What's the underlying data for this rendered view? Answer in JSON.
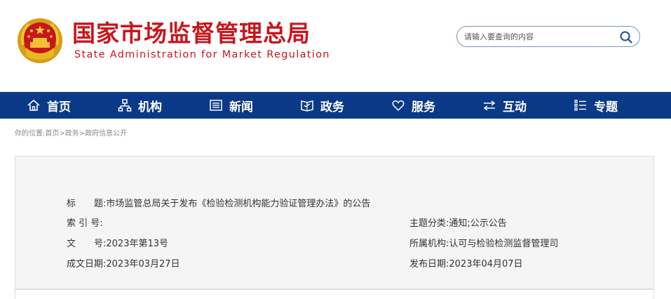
{
  "header": {
    "title_cn": "国家市场监督管理总局",
    "title_en": "State Administration for Market Regulation"
  },
  "search": {
    "placeholder": "请输入要查询的内容"
  },
  "nav": {
    "items": [
      {
        "label": "首页",
        "icon": "home-icon"
      },
      {
        "label": "机构",
        "icon": "org-chart-icon"
      },
      {
        "label": "新闻",
        "icon": "news-icon"
      },
      {
        "label": "政务",
        "icon": "government-affairs-icon"
      },
      {
        "label": "服务",
        "icon": "heart-icon"
      },
      {
        "label": "互动",
        "icon": "exchange-arrows-icon"
      },
      {
        "label": "专题",
        "icon": "list-icon"
      }
    ]
  },
  "breadcrumb": {
    "prefix": "你的位置:",
    "items": [
      "首页",
      "政务",
      "政府信息公开"
    ],
    "separator": ">"
  },
  "info": {
    "title_label": "标　　题:",
    "title_value": "市场监管总局关于发布《检验检测机构能力验证管理办法》的公告",
    "index_label": "索 引 号:",
    "index_value": "",
    "topic_label": "主题分类:",
    "topic_value": "通知;公示公告",
    "doc_no_label": "文　　号:",
    "doc_no_value": "2023年第13号",
    "org_label": "所属机构:",
    "org_value": "认可与检验检测监督管理司",
    "created_label": "成文日期:",
    "created_value": "2023年03月27日",
    "published_label": "发布日期:",
    "published_value": "2023年04月07日"
  },
  "colors": {
    "brand_red": "#c8161d",
    "nav_blue": "#0a3a87",
    "panel_bg": "#f5f5f5"
  }
}
